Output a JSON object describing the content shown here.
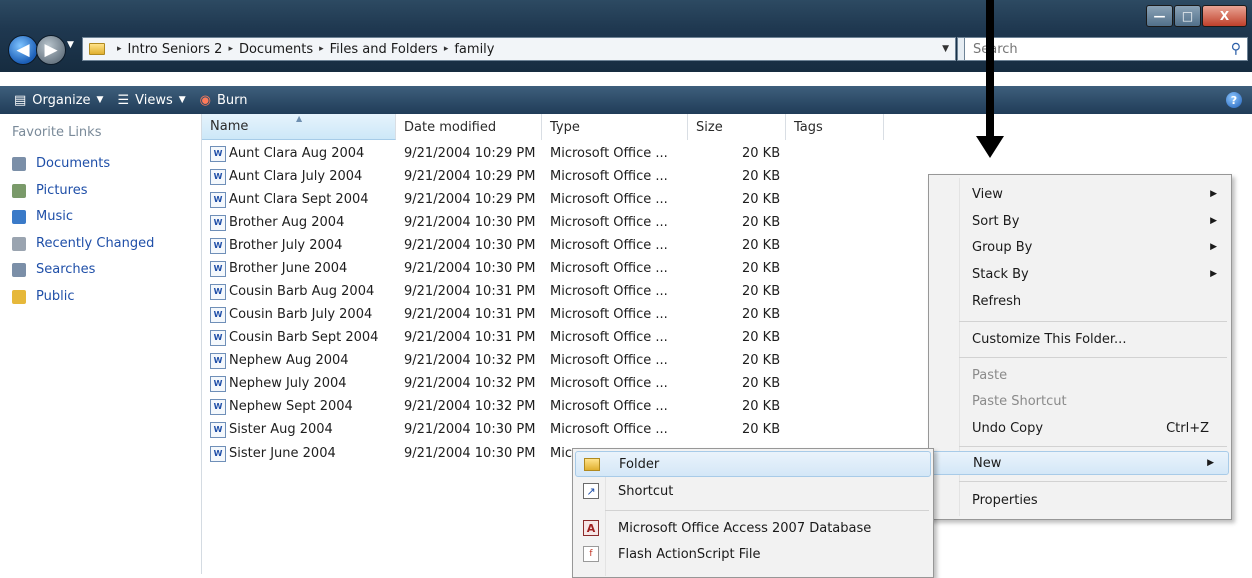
{
  "window": {
    "controls": {
      "minimize": "—",
      "maximize": "□",
      "close": "X"
    }
  },
  "address_bar": {
    "crumbs": [
      "Intro Seniors 2",
      "Documents",
      "Files and Folders",
      "family"
    ],
    "separator": "▸",
    "search_placeholder": "Search"
  },
  "toolbar": {
    "organize": "Organize",
    "views": "Views",
    "burn": "Burn",
    "help": "?"
  },
  "sidebar": {
    "title": "Favorite Links",
    "items": [
      {
        "label": "Documents",
        "icon": "documents-icon",
        "color": "#7b8fa8"
      },
      {
        "label": "Pictures",
        "icon": "pictures-icon",
        "color": "#7a9a6a"
      },
      {
        "label": "Music",
        "icon": "music-icon",
        "color": "#3a7ac8"
      },
      {
        "label": "Recently Changed",
        "icon": "recently-changed-icon",
        "color": "#9aa4b0"
      },
      {
        "label": "Searches",
        "icon": "searches-icon",
        "color": "#7b8fa8"
      },
      {
        "label": "Public",
        "icon": "public-folder-icon",
        "color": "#e6b83a"
      }
    ]
  },
  "columns": [
    "Name",
    "Date modified",
    "Type",
    "Size",
    "Tags"
  ],
  "files": [
    {
      "name": "Aunt Clara Aug 2004",
      "date": "9/21/2004 10:29 PM",
      "type": "Microsoft Office ...",
      "size": "20 KB"
    },
    {
      "name": "Aunt Clara July 2004",
      "date": "9/21/2004 10:29 PM",
      "type": "Microsoft Office ...",
      "size": "20 KB"
    },
    {
      "name": "Aunt Clara Sept 2004",
      "date": "9/21/2004 10:29 PM",
      "type": "Microsoft Office ...",
      "size": "20 KB"
    },
    {
      "name": "Brother Aug 2004",
      "date": "9/21/2004 10:30 PM",
      "type": "Microsoft Office ...",
      "size": "20 KB"
    },
    {
      "name": "Brother July 2004",
      "date": "9/21/2004 10:30 PM",
      "type": "Microsoft Office ...",
      "size": "20 KB"
    },
    {
      "name": "Brother June 2004",
      "date": "9/21/2004 10:30 PM",
      "type": "Microsoft Office ...",
      "size": "20 KB"
    },
    {
      "name": "Cousin Barb Aug 2004",
      "date": "9/21/2004 10:31 PM",
      "type": "Microsoft Office ...",
      "size": "20 KB"
    },
    {
      "name": "Cousin Barb July 2004",
      "date": "9/21/2004 10:31 PM",
      "type": "Microsoft Office ...",
      "size": "20 KB"
    },
    {
      "name": "Cousin Barb Sept 2004",
      "date": "9/21/2004 10:31 PM",
      "type": "Microsoft Office ...",
      "size": "20 KB"
    },
    {
      "name": "Nephew Aug 2004",
      "date": "9/21/2004 10:32 PM",
      "type": "Microsoft Office ...",
      "size": "20 KB"
    },
    {
      "name": "Nephew July 2004",
      "date": "9/21/2004 10:32 PM",
      "type": "Microsoft Office ...",
      "size": "20 KB"
    },
    {
      "name": "Nephew Sept 2004",
      "date": "9/21/2004 10:32 PM",
      "type": "Microsoft Office ...",
      "size": "20 KB"
    },
    {
      "name": "Sister Aug 2004",
      "date": "9/21/2004 10:30 PM",
      "type": "Microsoft Office ...",
      "size": "20 KB"
    },
    {
      "name": "Sister June 2004",
      "date": "9/21/2004 10:30 PM",
      "type": "Mic",
      "size": ""
    }
  ],
  "context_menu": {
    "items": [
      {
        "label": "View",
        "submenu": true
      },
      {
        "label": "Sort By",
        "submenu": true
      },
      {
        "label": "Group By",
        "submenu": true
      },
      {
        "label": "Stack By",
        "submenu": true
      },
      {
        "label": "Refresh"
      },
      {
        "label": "Customize This Folder..."
      },
      {
        "label": "Paste",
        "disabled": true
      },
      {
        "label": "Paste Shortcut",
        "disabled": true
      },
      {
        "label": "Undo Copy",
        "shortcut": "Ctrl+Z"
      },
      {
        "label": "New",
        "submenu": true,
        "highlighted": true
      },
      {
        "label": "Properties"
      }
    ]
  },
  "new_submenu": {
    "items": [
      {
        "label": "Folder",
        "icon": "folder-icon",
        "highlighted": true
      },
      {
        "label": "Shortcut",
        "icon": "shortcut-icon"
      },
      {
        "label": "Microsoft Office Access 2007 Database",
        "icon": "access-database-icon"
      },
      {
        "label": "Flash ActionScript File",
        "icon": "actionscript-file-icon"
      }
    ]
  },
  "colors": {
    "link": "#1f4fa8",
    "menu_highlight": "#d4e7f7",
    "toolbar": "#2f4e6c"
  }
}
